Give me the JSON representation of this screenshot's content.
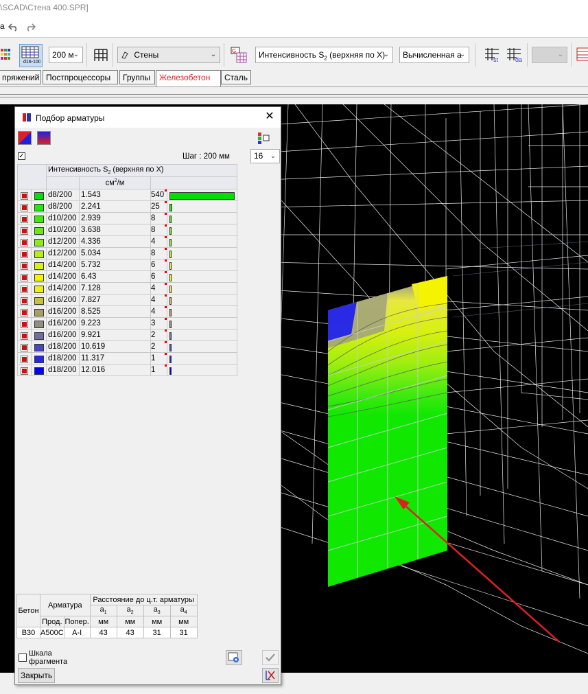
{
  "window": {
    "title_path": "\\SCAD\\Стена 400.SPR]"
  },
  "quickbar": {
    "label": "а"
  },
  "toolbar": {
    "step_combo": "200 м",
    "group_combo": "Стены",
    "factor_combo_prefix": "Интенсивность S",
    "factor_combo_sub": "2",
    "factor_combo_suffix": " (верхняя по X)",
    "mode_combo": "Вычисленная а"
  },
  "tabs": [
    {
      "label": "пряжений",
      "active": false
    },
    {
      "label": "Постпроцессоры",
      "active": false
    },
    {
      "label": "Группы",
      "active": false
    },
    {
      "label": "Железобетон",
      "active": true
    },
    {
      "label": "Сталь",
      "active": false
    }
  ],
  "dialog": {
    "title": "Подбор арматуры",
    "step_label": "Шаг : 200 мм",
    "count_value": "16",
    "col_header_prefix": "Интенсивность S",
    "col_header_sub": "2",
    "col_header_suffix": " (верхняя по X)",
    "unit_prefix": "см",
    "unit_sup": "2",
    "unit_suffix": "/м",
    "rows": [
      {
        "rebar": "d8/200",
        "value": "1.543",
        "count": "540",
        "count_num": 540,
        "color": "#00e000"
      },
      {
        "rebar": "d8/200",
        "value": "2.241",
        "count": "25",
        "count_num": 25,
        "color": "#20e810"
      },
      {
        "rebar": "d10/200",
        "value": "2.939",
        "count": "8",
        "count_num": 8,
        "color": "#40ea10"
      },
      {
        "rebar": "d10/200",
        "value": "3.638",
        "count": "8",
        "count_num": 8,
        "color": "#66ec10"
      },
      {
        "rebar": "d12/200",
        "value": "4.336",
        "count": "4",
        "count_num": 4,
        "color": "#8cee10"
      },
      {
        "rebar": "d12/200",
        "value": "5.034",
        "count": "8",
        "count_num": 8,
        "color": "#b4f010"
      },
      {
        "rebar": "d14/200",
        "value": "5.732",
        "count": "6",
        "count_num": 6,
        "color": "#d8f210"
      },
      {
        "rebar": "d14/200",
        "value": "6.43",
        "count": "6",
        "count_num": 6,
        "color": "#f4f400"
      },
      {
        "rebar": "d14/200",
        "value": "7.128",
        "count": "4",
        "count_num": 4,
        "color": "#ecec20"
      },
      {
        "rebar": "d16/200",
        "value": "7.827",
        "count": "4",
        "count_num": 4,
        "color": "#c8c040"
      },
      {
        "rebar": "d16/200",
        "value": "8.525",
        "count": "4",
        "count_num": 4,
        "color": "#a8a060"
      },
      {
        "rebar": "d16/200",
        "value": "9.223",
        "count": "3",
        "count_num": 3,
        "color": "#909080"
      },
      {
        "rebar": "d16/200",
        "value": "9.921",
        "count": "2",
        "count_num": 2,
        "color": "#7070a0"
      },
      {
        "rebar": "d18/200",
        "value": "10.619",
        "count": "2",
        "count_num": 2,
        "color": "#4848c0"
      },
      {
        "rebar": "d18/200",
        "value": "11.317",
        "count": "1",
        "count_num": 1,
        "color": "#2828e0"
      },
      {
        "rebar": "d18/200",
        "value": "12.016",
        "count": "1",
        "count_num": 1,
        "color": "#0000ff"
      }
    ],
    "props": {
      "beton_h": "Бетон",
      "armatura_h": "Арматура",
      "dist_h": "Расстояние до ц.т. арматуры",
      "a_labels": [
        "a",
        "a",
        "a",
        "a"
      ],
      "a_subs": [
        "1",
        "2",
        "3",
        "4"
      ],
      "prod_h": "Прод.",
      "poper_h": "Попер.",
      "mm_labels": [
        "мм",
        "мм",
        "мм",
        "мм"
      ],
      "beton": "В30",
      "prod": "А500С",
      "poper": "A-I",
      "a_values": [
        "43",
        "43",
        "31",
        "31"
      ]
    },
    "scale_label_1": "Шкала",
    "scale_label_2": "фрагмента",
    "close_label": "Закрыть"
  },
  "colors": {
    "accent_red": "#e02020",
    "viewport_bg": "#000000",
    "wire": "#ffffff"
  }
}
